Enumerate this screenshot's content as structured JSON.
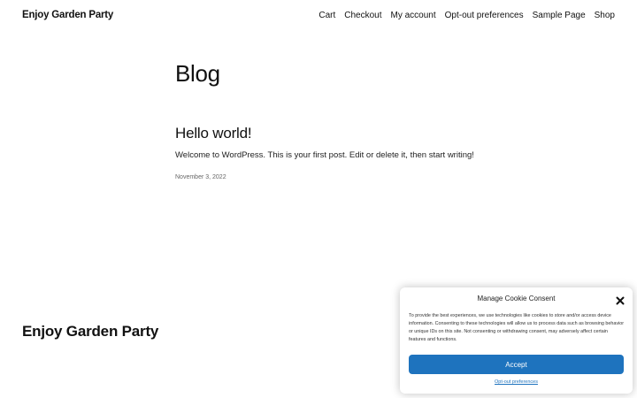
{
  "header": {
    "site_title": "Enjoy Garden Party",
    "nav_items": [
      "Cart",
      "Checkout",
      "My account",
      "Opt-out preferences",
      "Sample Page",
      "Shop"
    ]
  },
  "main": {
    "page_title": "Blog",
    "posts": [
      {
        "title": "Hello world!",
        "excerpt": "Welcome to WordPress. This is your first post. Edit or delete it, then start writing!",
        "date": "November 3, 2022"
      }
    ]
  },
  "footer": {
    "site_title": "Enjoy Garden Party"
  },
  "cookie_banner": {
    "title": "Manage Cookie Consent",
    "close_icon": "close-icon",
    "body": "To provide the best experiences, we use technologies like cookies to store and/or access device information. Consenting to these technologies will allow us to process data such as browsing behavior or unique IDs on this site. Not consenting or withdrawing consent, may adversely affect certain features and functions.",
    "accept_label": "Accept",
    "optout_label": "Opt-out preferences",
    "accent_color": "#1e73be"
  }
}
